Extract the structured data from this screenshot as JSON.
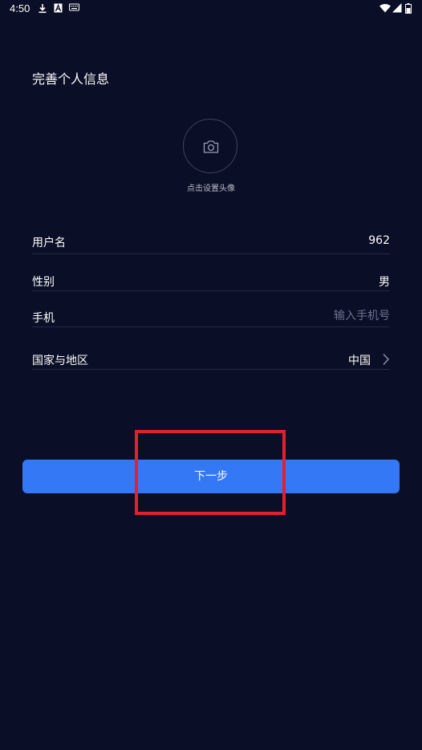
{
  "status_bar": {
    "time": "4:50",
    "icons": [
      "download-icon",
      "font-icon",
      "keyboard-icon",
      "wifi-icon",
      "signal-icon",
      "battery-icon"
    ]
  },
  "header": {
    "title": "完善个人信息"
  },
  "avatar": {
    "icon": "camera-icon",
    "hint": "点击设置头像"
  },
  "form": {
    "username": {
      "label": "用户名",
      "value": "962"
    },
    "gender": {
      "label": "性别",
      "value": "男"
    },
    "phone": {
      "label": "手机",
      "placeholder": "输入手机号",
      "value": ""
    },
    "country": {
      "label": "国家与地区",
      "value": "中国"
    }
  },
  "actions": {
    "next_label": "下一步"
  },
  "colors": {
    "background": "#0a0e26",
    "accent": "#3478f6",
    "highlight": "#e4202c",
    "divider": "#252a45"
  }
}
